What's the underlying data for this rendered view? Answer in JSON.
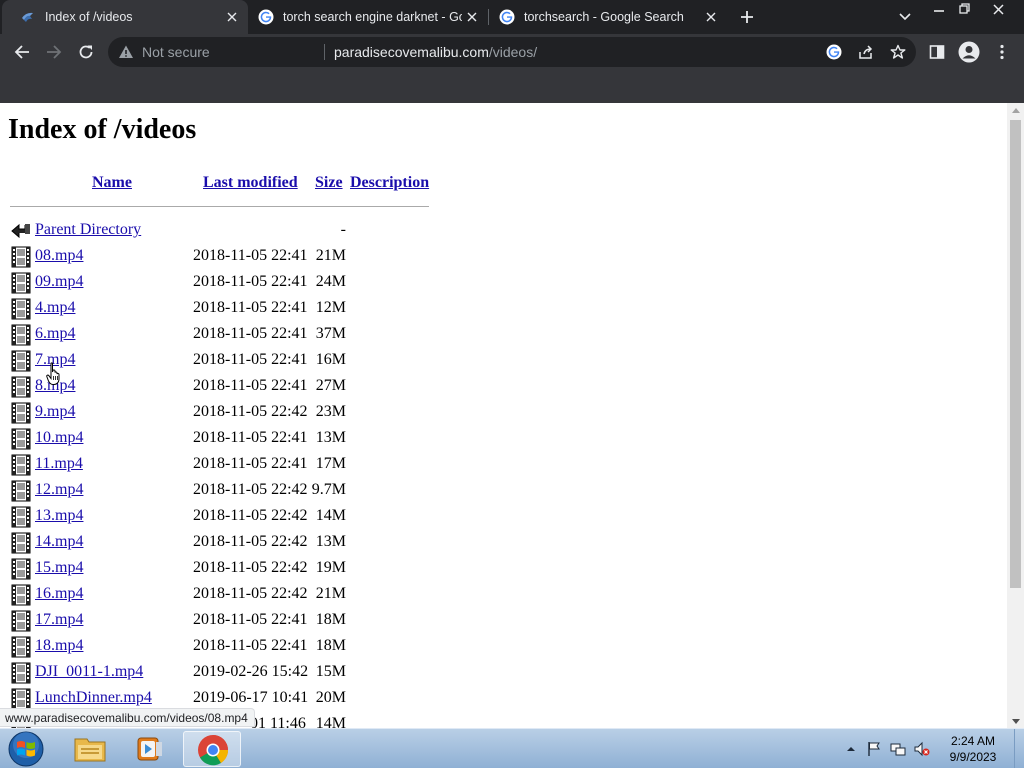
{
  "browser": {
    "tabs": [
      {
        "title": "Index of /videos"
      },
      {
        "title": "torch search engine darknet - Go"
      },
      {
        "title": "torchsearch - Google Search"
      }
    ],
    "omnibox": {
      "security_label": "Not secure",
      "host": "paradisecovemalibu.com",
      "path": "/videos/"
    }
  },
  "page": {
    "heading": "Index of /videos",
    "columns": {
      "name": "Name",
      "last_modified": "Last modified",
      "size": "Size",
      "description": "Description"
    },
    "parent": {
      "name": "Parent Directory",
      "size": "-"
    },
    "files": [
      {
        "name": "08.mp4",
        "modified": "2018-11-05 22:41",
        "size": "21M"
      },
      {
        "name": "09.mp4",
        "modified": "2018-11-05 22:41",
        "size": "24M"
      },
      {
        "name": "4.mp4",
        "modified": "2018-11-05 22:41",
        "size": "12M"
      },
      {
        "name": "6.mp4",
        "modified": "2018-11-05 22:41",
        "size": "37M"
      },
      {
        "name": "7.mp4",
        "modified": "2018-11-05 22:41",
        "size": "16M"
      },
      {
        "name": "8.mp4",
        "modified": "2018-11-05 22:41",
        "size": "27M"
      },
      {
        "name": "9.mp4",
        "modified": "2018-11-05 22:42",
        "size": "23M"
      },
      {
        "name": "10.mp4",
        "modified": "2018-11-05 22:41",
        "size": "13M"
      },
      {
        "name": "11.mp4",
        "modified": "2018-11-05 22:41",
        "size": "17M"
      },
      {
        "name": "12.mp4",
        "modified": "2018-11-05 22:42",
        "size": "9.7M"
      },
      {
        "name": "13.mp4",
        "modified": "2018-11-05 22:42",
        "size": "14M"
      },
      {
        "name": "14.mp4",
        "modified": "2018-11-05 22:42",
        "size": "13M"
      },
      {
        "name": "15.mp4",
        "modified": "2018-11-05 22:42",
        "size": "19M"
      },
      {
        "name": "16.mp4",
        "modified": "2018-11-05 22:42",
        "size": "21M"
      },
      {
        "name": "17.mp4",
        "modified": "2018-11-05 22:41",
        "size": "18M"
      },
      {
        "name": "18.mp4",
        "modified": "2018-11-05 22:41",
        "size": "18M"
      },
      {
        "name": "DJI_0011-1.mp4",
        "modified": "2019-02-26 15:42",
        "size": "15M"
      },
      {
        "name": "LunchDinner.mp4",
        "modified": "2019-06-17 10:41",
        "size": "20M"
      },
      {
        "name": "",
        "modified": "01 11:46",
        "size": "14M"
      }
    ],
    "status_url": "www.paradisecovemalibu.com/videos/08.mp4"
  },
  "taskbar": {
    "time": "2:24 AM",
    "date": "9/9/2023"
  },
  "colors": {
    "link": "#1a0dab",
    "chrome_dark": "#202124",
    "chrome_toolbar": "#35363a"
  }
}
